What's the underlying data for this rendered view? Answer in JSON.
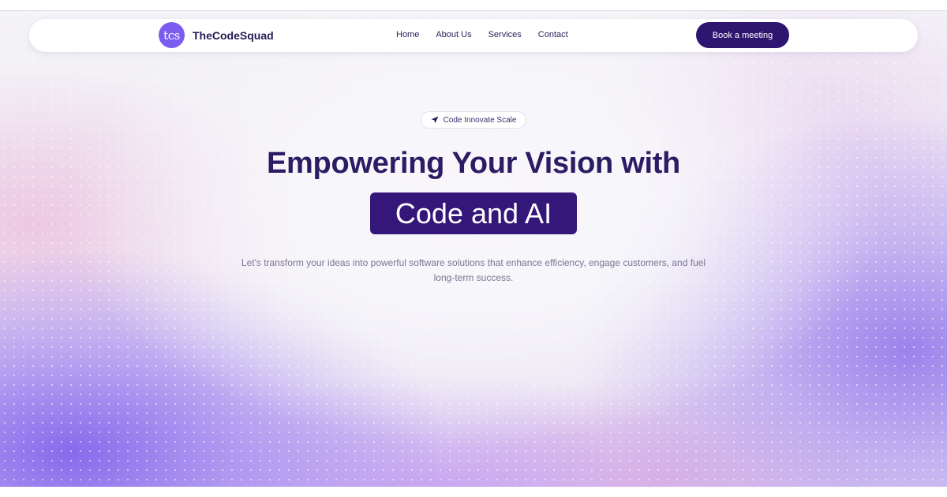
{
  "brand": {
    "logo_mark": "tcs",
    "name": "TheCodeSquad",
    "accent_color": "#7a5cf0"
  },
  "nav": {
    "links": [
      "Home",
      "About Us",
      "Services",
      "Contact"
    ],
    "cta_label": "Book a meeting",
    "cta_color": "#2e1670"
  },
  "hero": {
    "badge_icon": "send-arrow-icon",
    "badge_text": "Code Innovate Scale",
    "headline": "Empowering Your Vision with",
    "highlight": "Code and AI",
    "highlight_color": "#35177a",
    "subtext": "Let's transform your ideas into powerful software solutions that enhance efficiency, engage customers, and fuel long-term success."
  }
}
